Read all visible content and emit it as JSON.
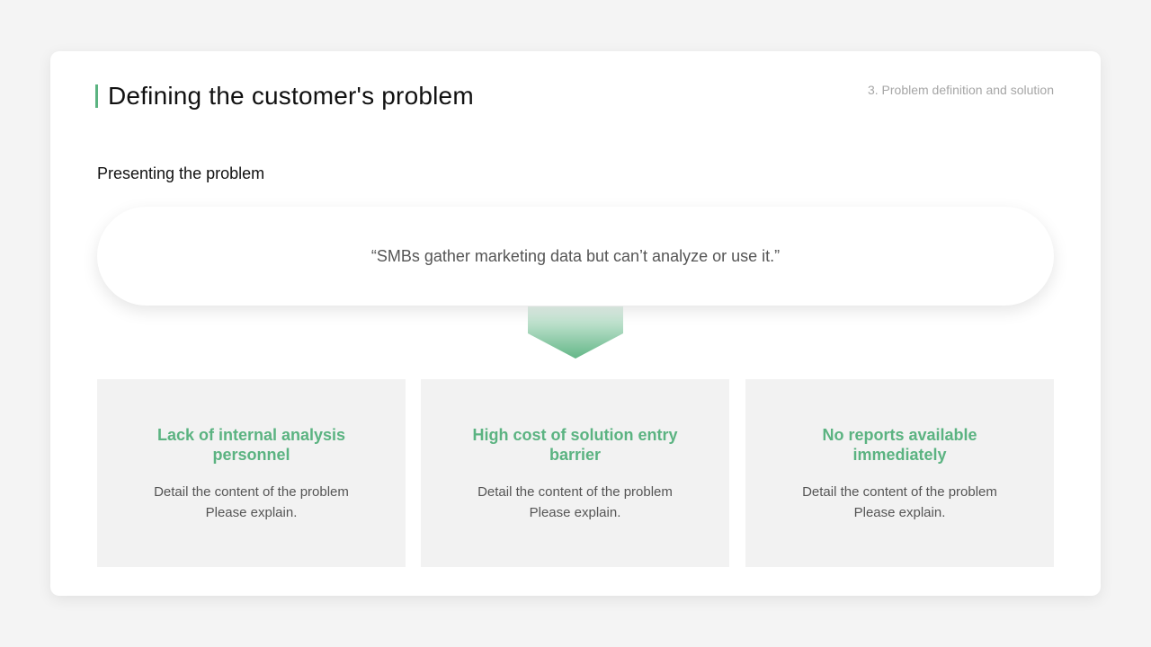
{
  "header": {
    "title": "Defining the customer's problem",
    "section": "3. Problem definition and solution"
  },
  "subtitle": "Presenting the problem",
  "quote": "“SMBs gather marketing data but can’t analyze or use it.”",
  "colors": {
    "accent": "#5bb381",
    "card_bg": "#f2f2f2",
    "page_bg": "#f4f4f4"
  },
  "cards": [
    {
      "title": "Lack of internal analysis personnel",
      "desc_line1": "Detail the content of the problem",
      "desc_line2": "Please explain."
    },
    {
      "title": "High cost of solution entry barrier",
      "desc_line1": "Detail the content of the problem",
      "desc_line2": "Please explain."
    },
    {
      "title": "No reports available immediately",
      "desc_line1": "Detail the content of the problem",
      "desc_line2": "Please explain."
    }
  ]
}
